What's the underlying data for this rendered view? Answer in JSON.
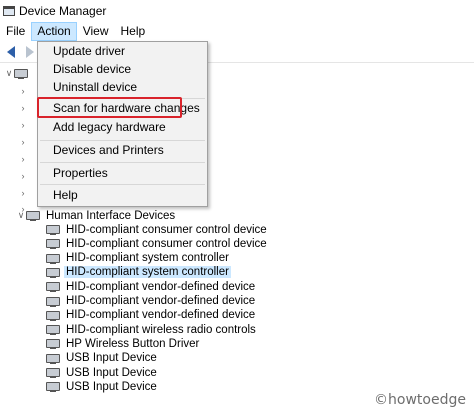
{
  "window": {
    "title": "Device Manager"
  },
  "menubar": {
    "items": [
      {
        "label": "File"
      },
      {
        "label": "Action",
        "active": true
      },
      {
        "label": "View"
      },
      {
        "label": "Help"
      }
    ]
  },
  "action_menu": {
    "items": {
      "update_driver": "Update driver",
      "disable_device": "Disable device",
      "uninstall_device": "Uninstall device",
      "scan_hardware": "Scan for hardware changes",
      "add_legacy": "Add legacy hardware",
      "devices_printers": "Devices and Printers",
      "properties": "Properties",
      "help": "Help"
    },
    "highlighted": "Scan for hardware changes",
    "highlight_color": "#d9232b"
  },
  "tree": {
    "category": "Human Interface Devices",
    "devices": [
      "HID-compliant consumer control device",
      "HID-compliant consumer control device",
      "HID-compliant system controller",
      "HID-compliant system controller",
      "HID-compliant vendor-defined device",
      "HID-compliant vendor-defined device",
      "HID-compliant vendor-defined device",
      "HID-compliant wireless radio controls",
      "HP Wireless Button Driver",
      "USB Input Device",
      "USB Input Device",
      "USB Input Device"
    ],
    "selected_index": 3
  },
  "watermark": "©howtoedge",
  "colors": {
    "selection": "#cce8ff",
    "menu_bg": "#f2f2f2"
  }
}
